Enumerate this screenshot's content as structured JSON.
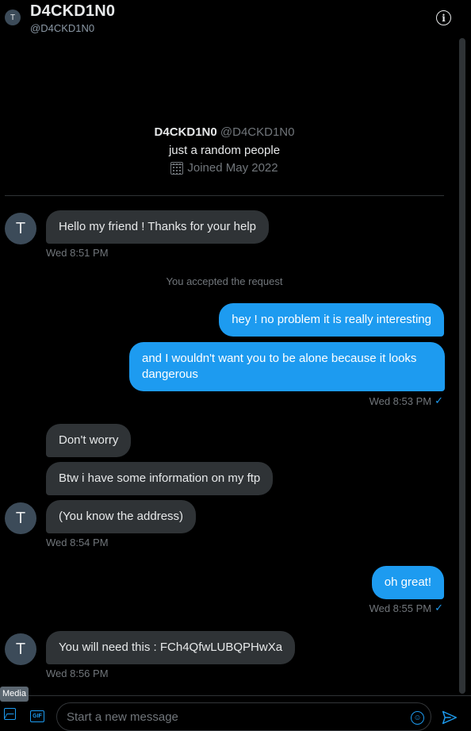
{
  "header": {
    "avatar_initial": "T",
    "name": "D4CKD1N0",
    "handle": "@D4CKD1N0",
    "info_glyph": "i"
  },
  "profile": {
    "name": "D4CKD1N0",
    "handle": "@D4CKD1N0",
    "bio": "just a random people",
    "joined": "Joined May 2022"
  },
  "messages": {
    "m1": "Hello my friend ! Thanks for your help",
    "m1_time": "Wed 8:51 PM",
    "system": "You accepted the request",
    "m2": "hey ! no problem it is really interesting",
    "m3": "and I wouldn't want you to be alone because it looks dangerous",
    "m3_time": "Wed 8:53 PM",
    "m4": "Don't worry",
    "m5": "Btw i have some information on my ftp",
    "m6": "(You know the address)",
    "m6_time": "Wed 8:54 PM",
    "m7": "oh great!",
    "m7_time": "Wed 8:55 PM",
    "m8": "You will need this : FCh4QfwLUBQPHwXa",
    "m8_time": "Wed 8:56 PM",
    "avatar_initial": "T",
    "sent_check": "✓"
  },
  "composer": {
    "media_tooltip": "Media",
    "gif_label": "GIF",
    "placeholder": "Start a new message",
    "emoji_glyph": "☺"
  },
  "colors": {
    "accent": "#1d9bf0",
    "incoming_bubble": "#2f3336",
    "background": "#000000"
  }
}
